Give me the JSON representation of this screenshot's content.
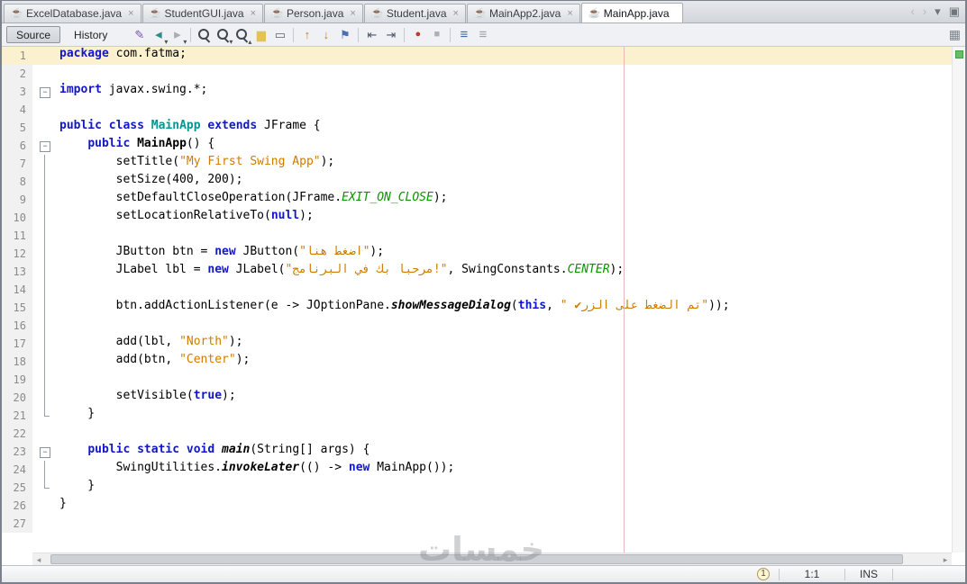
{
  "tabs": [
    {
      "label": "ExcelDatabase.java",
      "icon": "java-class-icon",
      "close": "×",
      "active": false,
      "interactable": "true"
    },
    {
      "label": "StudentGUI.java",
      "icon": "java-class-icon",
      "close": "×",
      "active": false,
      "interactable": "true"
    },
    {
      "label": "Person.java",
      "icon": "java-class-icon",
      "close": "×",
      "active": false,
      "interactable": "true"
    },
    {
      "label": "Student.java",
      "icon": "java-class-icon",
      "close": "×",
      "active": false,
      "interactable": "true"
    },
    {
      "label": "MainApp2.java",
      "icon": "java-main-class-icon",
      "close": "×",
      "active": false,
      "interactable": "true"
    },
    {
      "label": "MainApp.java",
      "icon": "java-main-class-icon",
      "close": "",
      "active": true,
      "interactable": "true"
    }
  ],
  "tab_controls": [
    {
      "name": "scroll-tabs-left-icon",
      "glyph": "‹",
      "style": "color:#b6bac0",
      "interactable": "true"
    },
    {
      "name": "scroll-tabs-right-icon",
      "glyph": "›",
      "style": "color:#b6bac0",
      "interactable": "true"
    },
    {
      "name": "tab-list-dropdown-icon",
      "glyph": "▾",
      "style": "color:#6f757d",
      "interactable": "true"
    },
    {
      "name": "maximize-editor-icon",
      "glyph": "▣",
      "style": "color:#6f757d",
      "interactable": "true"
    }
  ],
  "toolbar": {
    "source_label": "Source",
    "history_label": "History",
    "options_glyph": "▦",
    "icons": [
      {
        "name": "last-edited-icon",
        "glyph": "✎",
        "style": "color:#7b52ab",
        "interactable": "true"
      },
      {
        "name": "back-icon",
        "glyph": "◂",
        "style": "color:#2e8b8b;font-size:15px",
        "badge": "▾",
        "interactable": "true"
      },
      {
        "name": "forward-icon",
        "glyph": "▸",
        "style": "color:#a8adb3;font-size:15px",
        "badge": "▾",
        "interactable": "true"
      },
      {
        "name": "toolbar-separator",
        "is_sep": true,
        "interactable": "false"
      },
      {
        "name": "find-selection-icon",
        "shape": "mag",
        "glyph": "",
        "interactable": "true"
      },
      {
        "name": "find-next-occurrence-icon",
        "shape": "mag",
        "glyph": "",
        "badge": "▾",
        "interactable": "true"
      },
      {
        "name": "find-previous-occurrence-icon",
        "shape": "mag",
        "glyph": "",
        "badge": "▴",
        "interactable": "true"
      },
      {
        "name": "toggle-highlight-search-icon",
        "glyph": "▆",
        "style": "color:#e3c44c",
        "interactable": "true"
      },
      {
        "name": "rectangular-selection-icon",
        "glyph": "▭",
        "style": "color:#5a6068",
        "interactable": "true"
      },
      {
        "name": "toolbar-separator",
        "is_sep": true,
        "interactable": "false"
      },
      {
        "name": "previous-bookmark-icon",
        "glyph": "↑",
        "style": "color:#c07f2a;font-weight:bold",
        "interactable": "true"
      },
      {
        "name": "next-bookmark-icon",
        "glyph": "↓",
        "style": "color:#c07f2a;font-weight:bold",
        "interactable": "true"
      },
      {
        "name": "toggle-bookmark-icon",
        "glyph": "⚑",
        "style": "color:#4a6fb5",
        "interactable": "true"
      },
      {
        "name": "toolbar-separator",
        "is_sep": true,
        "interactable": "false"
      },
      {
        "name": "shift-line-left-icon",
        "glyph": "⇤",
        "style": "color:#4a5568",
        "interactable": "true"
      },
      {
        "name": "shift-line-right-icon",
        "glyph": "⇥",
        "style": "color:#4a5568",
        "interactable": "true"
      },
      {
        "name": "toolbar-separator",
        "is_sep": true,
        "interactable": "false"
      },
      {
        "name": "start-macro-recording-icon",
        "glyph": "●",
        "style": "color:#c0392b;font-size:11px",
        "interactable": "true"
      },
      {
        "name": "stop-macro-recording-icon",
        "glyph": "■",
        "style": "color:#aab0b6;font-size:11px",
        "interactable": "true"
      },
      {
        "name": "toolbar-separator",
        "is_sep": true,
        "interactable": "false"
      },
      {
        "name": "comment-icon",
        "glyph": "≡",
        "style": "color:#3a6ea5;font-size:15px",
        "interactable": "true"
      },
      {
        "name": "uncomment-icon",
        "glyph": "≡",
        "style": "color:#98a0a8;font-size:15px",
        "interactable": "true"
      }
    ]
  },
  "editor": {
    "current_line": 1,
    "watermark": "خمسات",
    "hscroll_left_glyph": "◂",
    "hscroll_right_glyph": "▸",
    "lines": [
      {
        "n": 1,
        "tokens": [
          [
            "package",
            "k"
          ],
          [
            " com.fatma;",
            "p"
          ]
        ]
      },
      {
        "n": 2,
        "tokens": []
      },
      {
        "n": 3,
        "fold": "box",
        "tokens": [
          [
            "import",
            "k"
          ],
          [
            " javax.swing.*;",
            "p"
          ]
        ]
      },
      {
        "n": 4,
        "tokens": []
      },
      {
        "n": 5,
        "tokens": [
          [
            "public",
            "k"
          ],
          [
            " ",
            "p"
          ],
          [
            "class",
            "k"
          ],
          [
            " ",
            "p"
          ],
          [
            "MainApp",
            "t"
          ],
          [
            " ",
            "p"
          ],
          [
            "extends",
            "k"
          ],
          [
            " JFrame {",
            "p"
          ]
        ]
      },
      {
        "n": 6,
        "fold": "box",
        "tokens": [
          [
            "    ",
            "p"
          ],
          [
            "public",
            "k"
          ],
          [
            " ",
            "p"
          ],
          [
            "MainApp",
            "m"
          ],
          [
            "() {",
            "p"
          ]
        ]
      },
      {
        "n": 7,
        "fold": "line",
        "tokens": [
          [
            "        setTitle(",
            "p"
          ],
          [
            "\"My First Swing App\"",
            "s"
          ],
          [
            ");",
            "p"
          ]
        ]
      },
      {
        "n": 8,
        "fold": "line",
        "tokens": [
          [
            "        setSize(400, 200);",
            "p"
          ]
        ]
      },
      {
        "n": 9,
        "fold": "line",
        "tokens": [
          [
            "        setDefaultCloseOperation(JFrame.",
            "p"
          ],
          [
            "EXIT_ON_CLOSE",
            "c"
          ],
          [
            ");",
            "p"
          ]
        ]
      },
      {
        "n": 10,
        "fold": "line",
        "tokens": [
          [
            "        setLocationRelativeTo(",
            "p"
          ],
          [
            "null",
            "k"
          ],
          [
            ");",
            "p"
          ]
        ]
      },
      {
        "n": 11,
        "fold": "line",
        "tokens": []
      },
      {
        "n": 12,
        "fold": "line",
        "tokens": [
          [
            "        JButton btn = ",
            "p"
          ],
          [
            "new",
            "k"
          ],
          [
            " JButton(",
            "p"
          ],
          [
            "\"اضغط هنا\"",
            "s"
          ],
          [
            ");",
            "p"
          ]
        ]
      },
      {
        "n": 13,
        "fold": "line",
        "tokens": [
          [
            "        JLabel lbl = ",
            "p"
          ],
          [
            "new",
            "k"
          ],
          [
            " JLabel(",
            "p"
          ],
          [
            "\"مرحبا بك في البرنامج!\"",
            "s"
          ],
          [
            ", SwingConstants.",
            "p"
          ],
          [
            "CENTER",
            "c"
          ],
          [
            ");",
            "p"
          ]
        ]
      },
      {
        "n": 14,
        "fold": "line",
        "tokens": []
      },
      {
        "n": 15,
        "fold": "line",
        "tokens": [
          [
            "        btn.addActionListener(e -> JOptionPane.",
            "p"
          ],
          [
            "showMessageDialog",
            "sm"
          ],
          [
            "(",
            "p"
          ],
          [
            "this",
            "k"
          ],
          [
            ", ",
            "p"
          ],
          [
            "\" ✔تم الضغط على الزر\"",
            "s"
          ],
          [
            "));",
            "p"
          ]
        ]
      },
      {
        "n": 16,
        "fold": "line",
        "tokens": []
      },
      {
        "n": 17,
        "fold": "line",
        "tokens": [
          [
            "        add(lbl, ",
            "p"
          ],
          [
            "\"North\"",
            "s"
          ],
          [
            ");",
            "p"
          ]
        ]
      },
      {
        "n": 18,
        "fold": "line",
        "tokens": [
          [
            "        add(btn, ",
            "p"
          ],
          [
            "\"Center\"",
            "s"
          ],
          [
            ");",
            "p"
          ]
        ]
      },
      {
        "n": 19,
        "fold": "line",
        "tokens": []
      },
      {
        "n": 20,
        "fold": "line",
        "tokens": [
          [
            "        setVisible(",
            "p"
          ],
          [
            "true",
            "k"
          ],
          [
            ");",
            "p"
          ]
        ]
      },
      {
        "n": 21,
        "fold": "end",
        "tokens": [
          [
            "    }",
            "p"
          ]
        ]
      },
      {
        "n": 22,
        "tokens": []
      },
      {
        "n": 23,
        "fold": "box",
        "tokens": [
          [
            "    ",
            "p"
          ],
          [
            "public",
            "k"
          ],
          [
            " ",
            "p"
          ],
          [
            "static",
            "k"
          ],
          [
            " ",
            "p"
          ],
          [
            "void",
            "k"
          ],
          [
            " ",
            "p"
          ],
          [
            "main",
            "sm"
          ],
          [
            "(String[] args) {",
            "p"
          ]
        ]
      },
      {
        "n": 24,
        "fold": "line",
        "tokens": [
          [
            "        SwingUtilities.",
            "p"
          ],
          [
            "invokeLater",
            "sm"
          ],
          [
            "(() -> ",
            "p"
          ],
          [
            "new",
            "k"
          ],
          [
            " MainApp());",
            "p"
          ]
        ]
      },
      {
        "n": 25,
        "fold": "end",
        "tokens": [
          [
            "    }",
            "p"
          ]
        ]
      },
      {
        "n": 26,
        "tokens": [
          [
            "}",
            "p"
          ]
        ]
      },
      {
        "n": 27,
        "tokens": []
      }
    ]
  },
  "status": {
    "notifications": "1",
    "caret_position": "1:1",
    "insert_mode": "INS"
  }
}
